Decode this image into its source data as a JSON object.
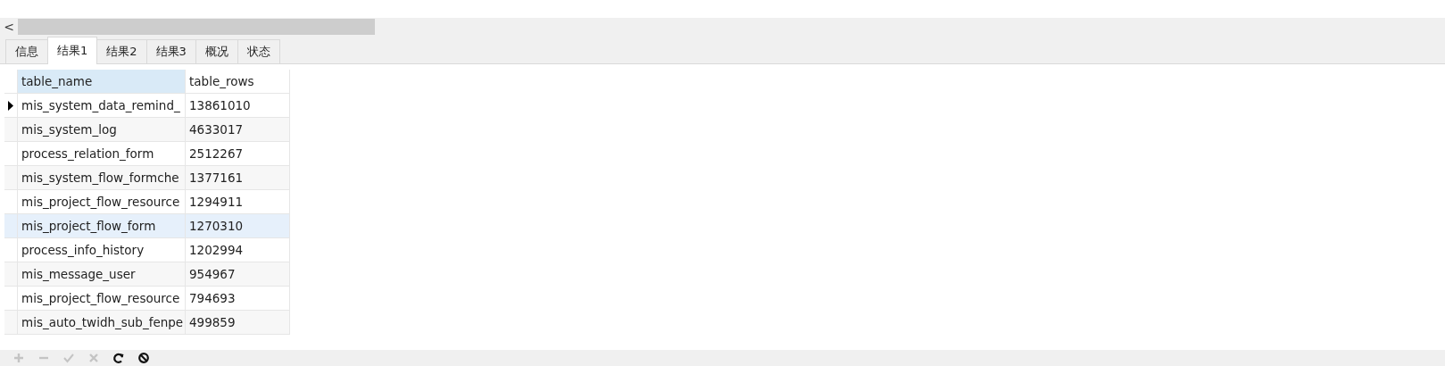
{
  "scrollbar": {
    "left_arrow": "<"
  },
  "tabs": [
    {
      "label": "信息",
      "selected": false
    },
    {
      "label": "结果1",
      "selected": true
    },
    {
      "label": "结果2",
      "selected": false
    },
    {
      "label": "结果3",
      "selected": false
    },
    {
      "label": "概况",
      "selected": false
    },
    {
      "label": "状态",
      "selected": false
    }
  ],
  "table": {
    "columns": [
      {
        "label": "table_name",
        "selected": true
      },
      {
        "label": "table_rows",
        "selected": false
      }
    ],
    "rows": [
      {
        "cells": [
          "mis_system_data_remind_",
          "13861010"
        ],
        "current": true,
        "hovered": false
      },
      {
        "cells": [
          "mis_system_log",
          "4633017"
        ],
        "current": false,
        "hovered": false
      },
      {
        "cells": [
          "process_relation_form",
          "2512267"
        ],
        "current": false,
        "hovered": false
      },
      {
        "cells": [
          "mis_system_flow_formche",
          "1377161"
        ],
        "current": false,
        "hovered": false
      },
      {
        "cells": [
          "mis_project_flow_resource",
          "1294911"
        ],
        "current": false,
        "hovered": false
      },
      {
        "cells": [
          "mis_project_flow_form",
          "1270310"
        ],
        "current": false,
        "hovered": true
      },
      {
        "cells": [
          "process_info_history",
          "1202994"
        ],
        "current": false,
        "hovered": false
      },
      {
        "cells": [
          "mis_message_user",
          "954967"
        ],
        "current": false,
        "hovered": false
      },
      {
        "cells": [
          "mis_project_flow_resource",
          "794693"
        ],
        "current": false,
        "hovered": false
      },
      {
        "cells": [
          "mis_auto_twidh_sub_fenpe",
          "499859"
        ],
        "current": false,
        "hovered": false
      }
    ]
  },
  "toolbar": [
    {
      "kind": "add",
      "disabled": true
    },
    {
      "kind": "remove",
      "disabled": true
    },
    {
      "kind": "apply",
      "disabled": true
    },
    {
      "kind": "cancel",
      "disabled": true
    },
    {
      "kind": "refresh",
      "disabled": false
    },
    {
      "kind": "stop",
      "disabled": false
    }
  ]
}
